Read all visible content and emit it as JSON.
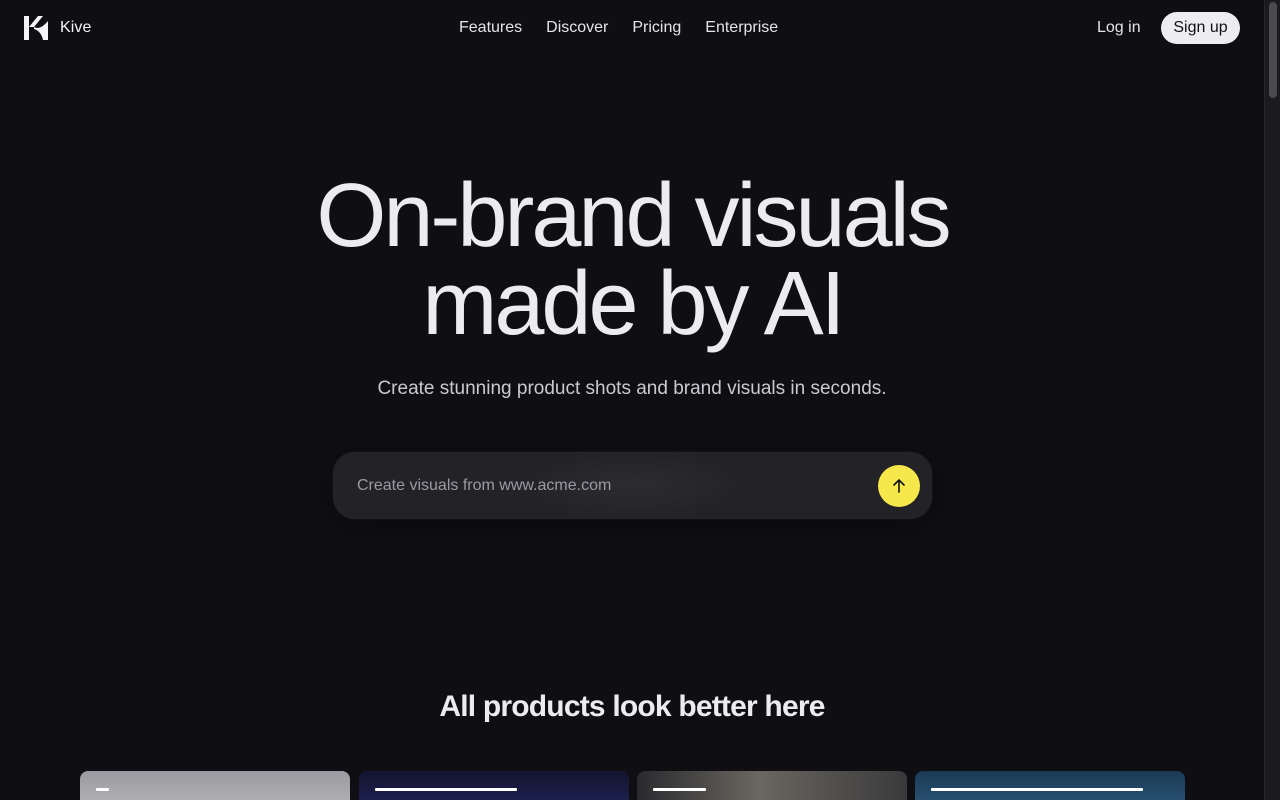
{
  "header": {
    "brand": "Kive",
    "nav": [
      {
        "label": "Features"
      },
      {
        "label": "Discover"
      },
      {
        "label": "Pricing"
      },
      {
        "label": "Enterprise"
      }
    ],
    "login_label": "Log in",
    "signup_label": "Sign up"
  },
  "hero": {
    "title_line1": "On-brand visuals",
    "title_line2": "made by AI",
    "subtitle": "Create stunning product shots and brand visuals in seconds.",
    "search_placeholder": "Create visuals from www.acme.com"
  },
  "section": {
    "title": "All products look better here"
  },
  "colors": {
    "background": "#0f0f13",
    "accent_button": "#f6e84b",
    "signup_bg": "#ededf0"
  },
  "icons": {
    "logo": "kive-logo-icon",
    "submit": "arrow-up-icon"
  }
}
